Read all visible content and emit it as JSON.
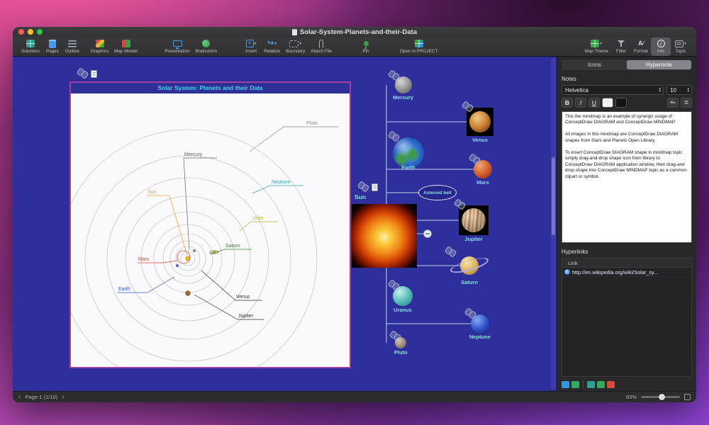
{
  "window": {
    "title": "Solar-System-Planets-and-their-Data"
  },
  "toolbar": {
    "items": [
      {
        "label": "Solutions"
      },
      {
        "label": "Pages"
      },
      {
        "label": "Outline"
      },
      {
        "label": "Graphics"
      },
      {
        "label": "Map Minder"
      },
      {
        "label": "Presentation"
      },
      {
        "label": "Brainstorm"
      },
      {
        "label": "Insert"
      },
      {
        "label": "Relation"
      },
      {
        "label": "Boundary"
      },
      {
        "label": "Attach File"
      },
      {
        "label": "Pin"
      },
      {
        "label": "Open in PROJECT"
      },
      {
        "label": "Map Theme"
      },
      {
        "label": "Filter"
      },
      {
        "label": "Format"
      },
      {
        "label": "Info"
      },
      {
        "label": "Topic"
      }
    ]
  },
  "canvas": {
    "diagram": {
      "title": "Solar System: Planets and their Data",
      "orbit_labels": [
        {
          "name": "Pluto",
          "color": "#8a8a8a"
        },
        {
          "name": "Mercury",
          "color": "#606060"
        },
        {
          "name": "Neptune",
          "color": "#30a8b8"
        },
        {
          "name": "Sun",
          "color": "#e8a030"
        },
        {
          "name": "Uran",
          "color": "#b8b030"
        },
        {
          "name": "Saturn",
          "color": "#2a8a2a"
        },
        {
          "name": "Mars",
          "color": "#d84030"
        },
        {
          "name": "Earth",
          "color": "#2858c0"
        },
        {
          "name": "Venus",
          "color": "#303030"
        },
        {
          "name": "Jupiter",
          "color": "#303030"
        }
      ]
    },
    "mindmap": {
      "root": "Sun",
      "topics": [
        "Mercury",
        "Venus",
        "Earth",
        "Mars",
        "Asteroid belt",
        "Jupiter",
        "Saturn",
        "Uranus",
        "Neptune",
        "Pluto"
      ]
    }
  },
  "sidebar": {
    "tabs": [
      {
        "label": "Icons"
      },
      {
        "label": "Hypernote",
        "selected": true
      }
    ],
    "notes": {
      "heading": "Notes",
      "font_name": "Helvetica",
      "font_size": "10",
      "buttons": {
        "bold": "B",
        "italic": "I",
        "underline": "U"
      },
      "text": "This the mindmap is an example of synergic usage of ConceptDraw DIAGRAM and ConceptDraw MINDMAP.\n\nAll images in this mindmap are ConceptDraw DIAGRAM shapes from Stars and Planets Open Library.\n\nTo insert ConceptDraw DIAGRAM shape in mindmap topic simply drag-and-drop shape icon from library to ConceptDraw DIAGRAM application window, then drag-and drop shape into ConceptDraw MINDMAP topic as a common clipart or symbol."
    },
    "hyperlinks": {
      "heading": "Hyperlinks",
      "column_header": "Link",
      "links": [
        {
          "url": "http://en.wikipedia.org/wiki/Solar_sy..."
        }
      ]
    }
  },
  "statusbar": {
    "page_label": "Page-1 (1/10)",
    "zoom_label": "83%"
  },
  "colors": {
    "canvas_bg": "#2e2e9c",
    "panel_border": "#a040a0",
    "topic_label": "#8edce8"
  }
}
